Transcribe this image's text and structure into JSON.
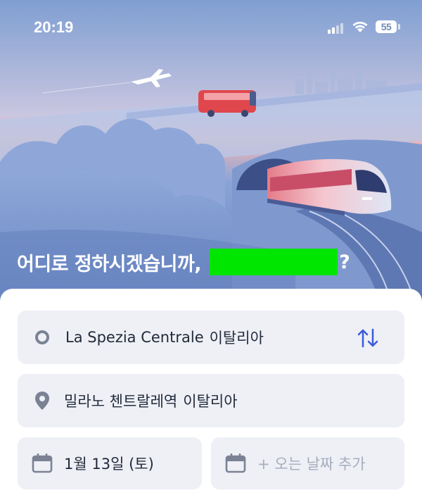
{
  "status_bar": {
    "time": "20:19",
    "battery": "55",
    "icons": [
      "signal-icon",
      "wifi-icon",
      "battery-icon"
    ]
  },
  "hero": {
    "illustration": "train-bus-plane-illustration",
    "greeting": "어디로 정하시겠습니까,",
    "name_redacted": true,
    "question_mark": "?"
  },
  "search": {
    "origin": {
      "name": "La Spezia Centrale",
      "country": "이탈리아",
      "icon": "origin-dot-icon"
    },
    "swap_icon": "swap-arrows-icon",
    "destination": {
      "name": "밀라노 첸트랄레역",
      "country": "이탈리아",
      "icon": "location-pin-icon"
    },
    "departure_date": "1월 13일 (토)",
    "return_placeholder": "+ 오는 날짜 추가",
    "calendar_icon": "calendar-icon"
  },
  "colors": {
    "sky_top": "#8aa6d4",
    "sky_bottom": "#6f8fc4",
    "sunset": "#f3a9a6",
    "field_bg": "#eef0f6",
    "icon_gray": "#7a8294",
    "accent_blue": "#3a5bd9",
    "redaction": "#00e600"
  }
}
